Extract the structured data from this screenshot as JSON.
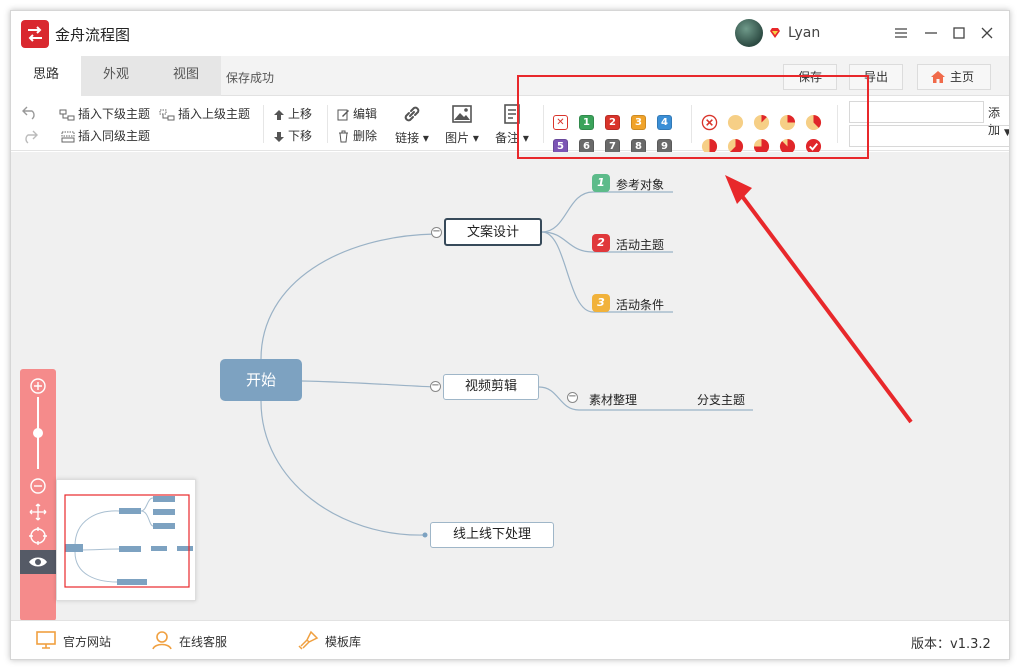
{
  "app": {
    "title": "金舟流程图",
    "user_name": "Lyan"
  },
  "tabs": [
    {
      "label": "思路",
      "active": true
    },
    {
      "label": "外观",
      "active": false
    },
    {
      "label": "视图",
      "active": false
    }
  ],
  "save_status": "保存成功",
  "top_buttons": {
    "save": "保存",
    "export": "导出",
    "home": "主页"
  },
  "toolbar": {
    "insert_child": "插入下级主题",
    "insert_parent": "插入上级主题",
    "insert_sibling": "插入同级主题",
    "move_up": "上移",
    "move_down": "下移",
    "edit": "编辑",
    "delete": "删除",
    "link": "链接",
    "image": "图片",
    "note": "备注",
    "add_label": "添加",
    "input_value": "",
    "select_value": ""
  },
  "priority_icons": [
    {
      "label": "",
      "color": "#ffffff",
      "type": "clear"
    },
    {
      "label": "1",
      "color": "#3aa35a"
    },
    {
      "label": "2",
      "color": "#d9342b"
    },
    {
      "label": "3",
      "color": "#f0a32a"
    },
    {
      "label": "4",
      "color": "#3b8fd6"
    },
    {
      "label": "5",
      "color": "#7c55b5"
    },
    {
      "label": "6",
      "color": "#6a6a6a"
    },
    {
      "label": "7",
      "color": "#6a6a6a"
    },
    {
      "label": "8",
      "color": "#6a6a6a"
    },
    {
      "label": "9",
      "color": "#6a6a6a"
    }
  ],
  "progress_icons": [
    {
      "name": "clear-icon",
      "fraction": -1
    },
    {
      "name": "progress-0-icon",
      "fraction": 0
    },
    {
      "name": "progress-1-8-icon",
      "fraction": 0.125
    },
    {
      "name": "progress-1-4-icon",
      "fraction": 0.25
    },
    {
      "name": "progress-3-8-icon",
      "fraction": 0.375
    },
    {
      "name": "progress-1-2-icon",
      "fraction": 0.5
    },
    {
      "name": "progress-5-8-icon",
      "fraction": 0.625
    },
    {
      "name": "progress-3-4-icon",
      "fraction": 0.75
    },
    {
      "name": "progress-7-8-icon",
      "fraction": 0.875
    },
    {
      "name": "progress-done-icon",
      "fraction": 1
    }
  ],
  "mindmap": {
    "root": "开始",
    "branches": [
      {
        "label": "文案设计",
        "children": [
          {
            "label": "参考对象",
            "priority": "1",
            "color": "#5dbb8a"
          },
          {
            "label": "活动主题",
            "priority": "2",
            "color": "#e0383b"
          },
          {
            "label": "活动条件",
            "priority": "3",
            "color": "#f1b23b"
          }
        ]
      },
      {
        "label": "视频剪辑",
        "children": [
          {
            "label": "素材整理"
          },
          {
            "label": "分支主题"
          }
        ]
      },
      {
        "label": "线上线下处理",
        "children": []
      }
    ]
  },
  "statusbar": {
    "website": "官方网站",
    "support": "在线客服",
    "templates": "模板库",
    "version": "版本：v1.3.2"
  },
  "colors": {
    "accent_red": "#d9282f",
    "node_blue": "#7da2c1",
    "zoom_panel": "#f58b8b",
    "annotation": "#e8282b"
  }
}
